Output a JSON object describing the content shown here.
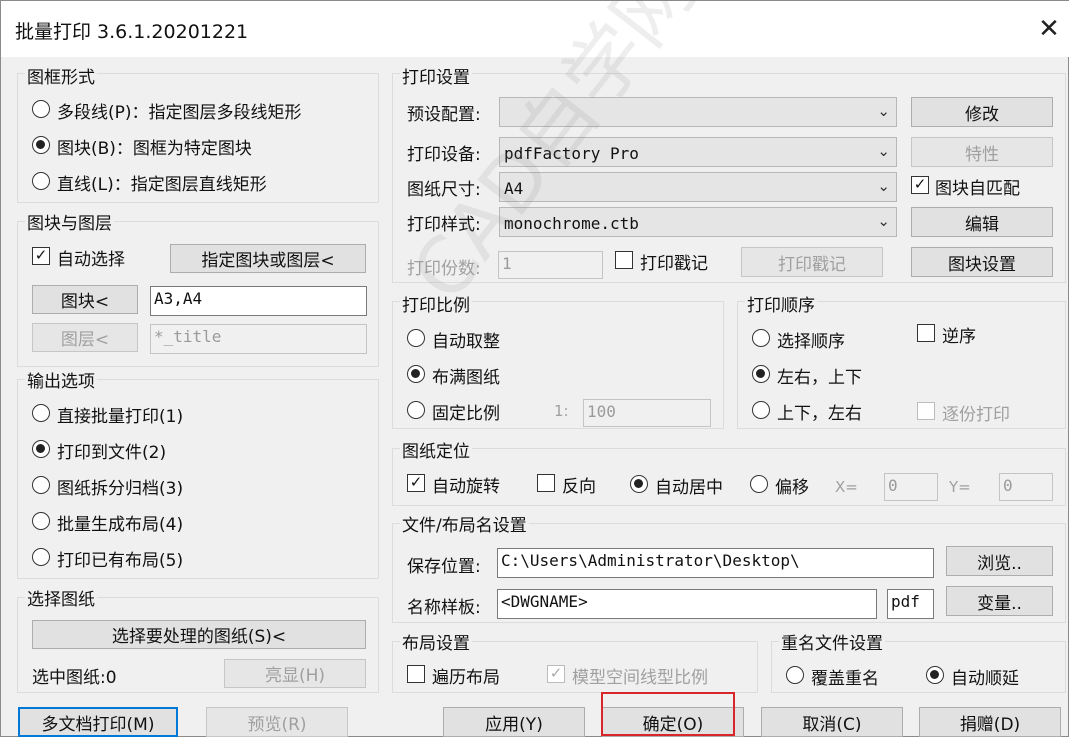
{
  "window": {
    "title": "批量打印 3.6.1.20201221"
  },
  "frame_group": {
    "title": "图框形式",
    "options": [
      {
        "label": "多段线(P)：指定图层多段线矩形",
        "selected": false
      },
      {
        "label": "图块(B)：图框为特定图块",
        "selected": true
      },
      {
        "label": "直线(L)：指定图层直线矩形",
        "selected": false
      }
    ]
  },
  "block_layer": {
    "title": "图块与图层",
    "auto_select_label": "自动选择",
    "auto_select_checked": true,
    "pick_button": "指定图块或图层<",
    "block_button": "图块<",
    "block_value": "A3,A4",
    "layer_button": "图层<",
    "layer_value": "*_title"
  },
  "output": {
    "title": "输出选项",
    "options": [
      {
        "label": "直接批量打印(1)",
        "selected": false
      },
      {
        "label": "打印到文件(2)",
        "selected": true
      },
      {
        "label": "图纸拆分归档(3)",
        "selected": false
      },
      {
        "label": "批量生成布局(4)",
        "selected": false
      },
      {
        "label": "打印已有布局(5)",
        "selected": false
      }
    ]
  },
  "select_paper": {
    "title": "选择图纸",
    "select_button": "选择要处理的图纸(S)<",
    "selected_label": "选中图纸:0",
    "highlight_button": "亮显(H)"
  },
  "print_settings": {
    "title": "打印设置",
    "preset_label": "预设配置:",
    "preset_value": "",
    "modify_button": "修改",
    "device_label": "打印设备:",
    "device_value": "pdfFactory Pro",
    "props_button": "特性",
    "size_label": "图纸尺寸:",
    "size_value": "A4",
    "autofit_label": "图块自匹配",
    "autofit_checked": true,
    "style_label": "打印样式:",
    "style_value": "monochrome.ctb",
    "edit_button": "编辑",
    "copies_label": "打印份数:",
    "copies_value": "1",
    "stamp_label": "打印戳记",
    "stamp_checked": false,
    "stamp_button": "打印戳记",
    "block_settings_button": "图块设置"
  },
  "scale": {
    "title": "打印比例",
    "options": [
      {
        "label": "自动取整",
        "selected": false
      },
      {
        "label": "布满图纸",
        "selected": true
      },
      {
        "label": "固定比例",
        "selected": false
      }
    ],
    "ratio_prefix": "1:",
    "ratio_value": "100"
  },
  "order": {
    "title": "打印顺序",
    "options": [
      {
        "label": "选择顺序",
        "selected": false
      },
      {
        "label": "左右，上下",
        "selected": true
      },
      {
        "label": "上下，左右",
        "selected": false
      }
    ],
    "reverse_label": "逆序",
    "reverse_checked": false,
    "collate_label": "逐份打印"
  },
  "position": {
    "title": "图纸定位",
    "auto_rotate_label": "自动旋转",
    "auto_rotate_checked": true,
    "reverse_label": "反向",
    "reverse_checked": false,
    "center_label": "自动居中",
    "center_selected": true,
    "offset_label": "偏移",
    "offset_selected": false,
    "x_label": "X=",
    "x_value": "0",
    "y_label": "Y=",
    "y_value": "0"
  },
  "file_name": {
    "title": "文件/布局名设置",
    "save_label": "保存位置:",
    "save_value": "C:\\Users\\Administrator\\Desktop\\",
    "browse_button": "浏览..",
    "template_label": "名称样板:",
    "template_value": "<DWGNAME>",
    "ext_value": "pdf",
    "var_button": "变量.."
  },
  "layout": {
    "title": "布局设置",
    "traverse_label": "遍历布局",
    "traverse_checked": false,
    "model_scale_label": "模型空间线型比例",
    "model_scale_checked": true
  },
  "rename": {
    "title": "重名文件设置",
    "overwrite_label": "覆盖重名",
    "overwrite_selected": false,
    "auto_label": "自动顺延",
    "auto_selected": true
  },
  "footer": {
    "multi_button": "多文档打印(M)",
    "preview_button": "预览(R)",
    "apply_button": "应用(Y)",
    "ok_button": "确定(O)",
    "cancel_button": "取消(C)",
    "donate_button": "捐赠(D)"
  },
  "watermark": "CAD自学网 www.cadzxw.com"
}
